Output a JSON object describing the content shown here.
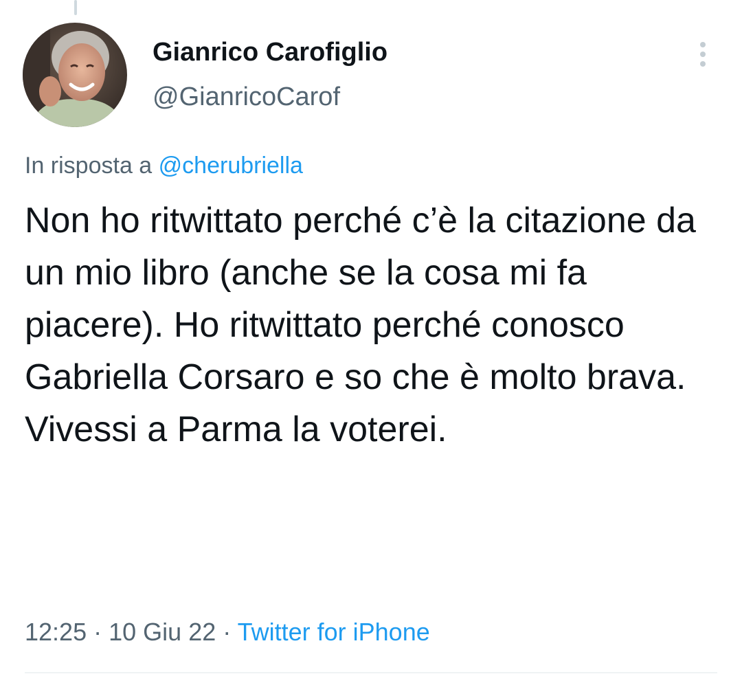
{
  "author": {
    "name": "Gianrico Carofiglio",
    "handle": "@GianricoCarof",
    "avatar": "avatar-photo"
  },
  "reply": {
    "prefix": "In risposta a",
    "mention": "@cherubriella"
  },
  "tweet": {
    "text": "Non ho ritwittato perché c’è la citazione da un mio libro (anche se la cosa mi fa piacere). Ho ritwittato perché conosco Gabriella Corsaro e so che è molto brava. Vivessi a Parma la voterei."
  },
  "meta": {
    "time": "12:25",
    "separator": "·",
    "date": "10 Giu 22",
    "source": "Twitter for iPhone"
  },
  "icons": {
    "more": "more-vertical-icon"
  },
  "colors": {
    "text": "#0f1419",
    "secondary": "#536471",
    "link": "#1d9bf0",
    "divider": "#eff3f4"
  }
}
